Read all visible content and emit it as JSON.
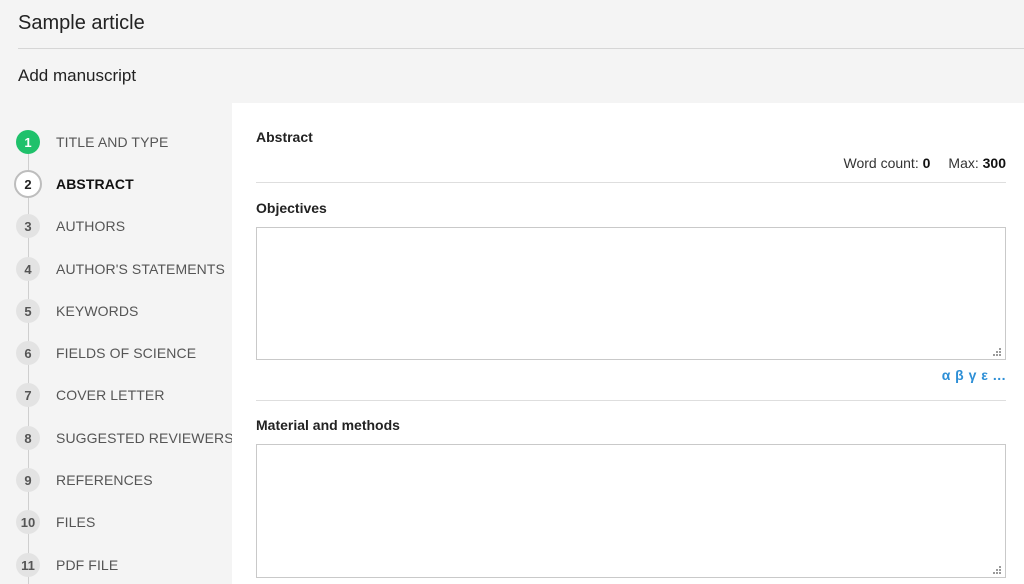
{
  "header": {
    "title": "Sample article",
    "subtitle": "Add manuscript"
  },
  "steps": [
    {
      "number": "1",
      "label": "TITLE AND TYPE",
      "state": "done"
    },
    {
      "number": "2",
      "label": "ABSTRACT",
      "state": "active"
    },
    {
      "number": "3",
      "label": "AUTHORS",
      "state": "pending"
    },
    {
      "number": "4",
      "label": "AUTHOR'S STATEMENTS",
      "state": "pending"
    },
    {
      "number": "5",
      "label": "KEYWORDS",
      "state": "pending"
    },
    {
      "number": "6",
      "label": "FIELDS OF SCIENCE",
      "state": "pending"
    },
    {
      "number": "7",
      "label": "COVER LETTER",
      "state": "pending"
    },
    {
      "number": "8",
      "label": "SUGGESTED REVIEWERS",
      "state": "pending"
    },
    {
      "number": "9",
      "label": "REFERENCES",
      "state": "pending"
    },
    {
      "number": "10",
      "label": "FILES",
      "state": "pending"
    },
    {
      "number": "11",
      "label": "PDF FILE",
      "state": "pending"
    }
  ],
  "abstract": {
    "heading": "Abstract",
    "word_count_label": "Word count:",
    "word_count_value": "0",
    "max_label": "Max:",
    "max_value": "300",
    "objectives": {
      "label": "Objectives",
      "value": ""
    },
    "special_chars_link": "α β γ ε ...",
    "methods": {
      "label": "Material and methods",
      "value": ""
    }
  },
  "colors": {
    "done_badge": "#1fc16b",
    "link": "#2d8fd6",
    "panel_bg": "#ffffff",
    "page_bg": "#f4f4f4"
  }
}
